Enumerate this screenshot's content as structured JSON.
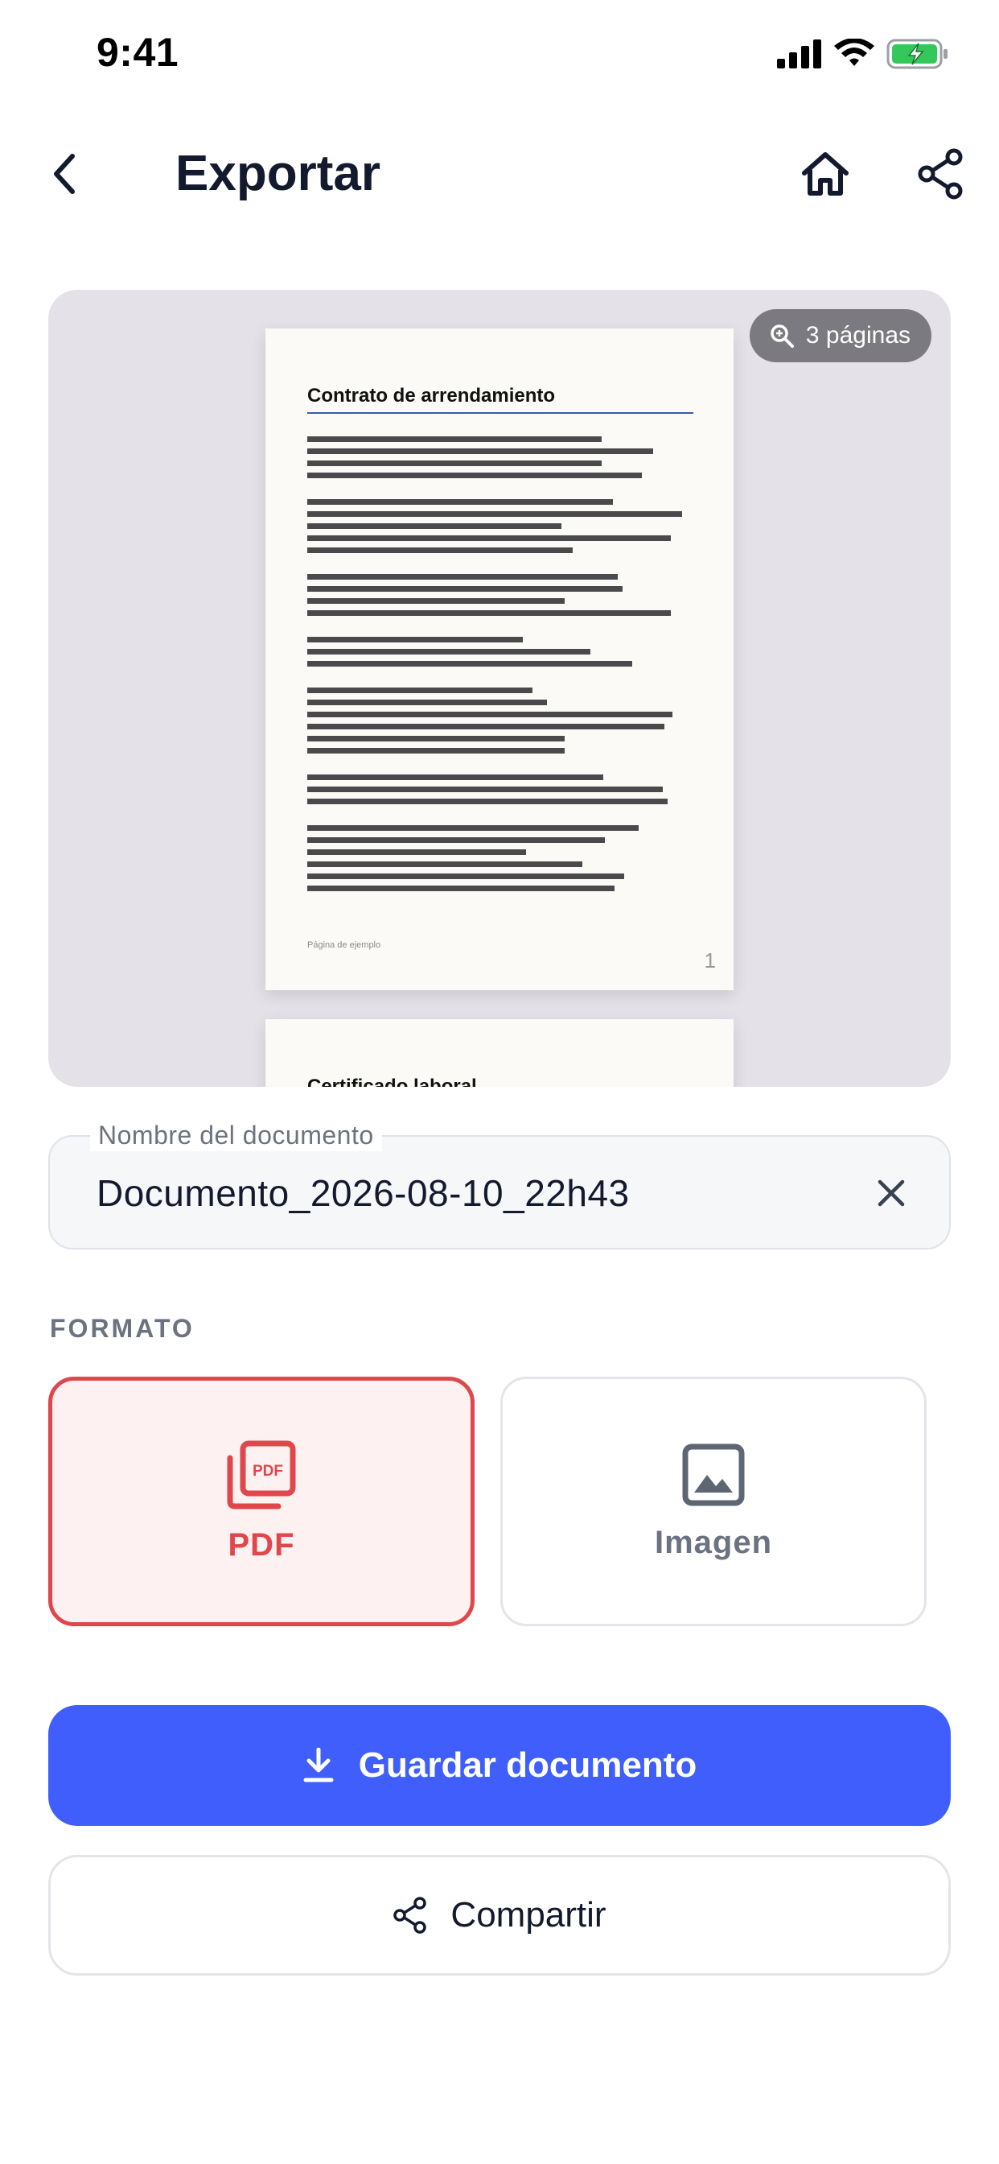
{
  "status_bar": {
    "time": "9:41"
  },
  "header": {
    "title": "Exportar"
  },
  "preview": {
    "page_count_label": "3 páginas",
    "page1": {
      "title": "Contrato de arrendamiento",
      "footer": "Página de ejemplo",
      "number": "1"
    },
    "page2": {
      "title": "Certificado laboral"
    }
  },
  "name_field": {
    "label": "Nombre del documento",
    "value": "Documento_2026-08-10_22h43"
  },
  "format": {
    "section_label": "FORMATO",
    "options": [
      {
        "label": "PDF",
        "selected": true
      },
      {
        "label": "Imagen",
        "selected": false
      }
    ]
  },
  "actions": {
    "save_label": "Guardar documento",
    "share_label": "Compartir"
  },
  "colors": {
    "primary": "#3f5efb",
    "pdf_accent": "#e0474c",
    "title_text": "#141a2e",
    "muted_text": "#6b7280",
    "battery_green": "#34c759"
  }
}
